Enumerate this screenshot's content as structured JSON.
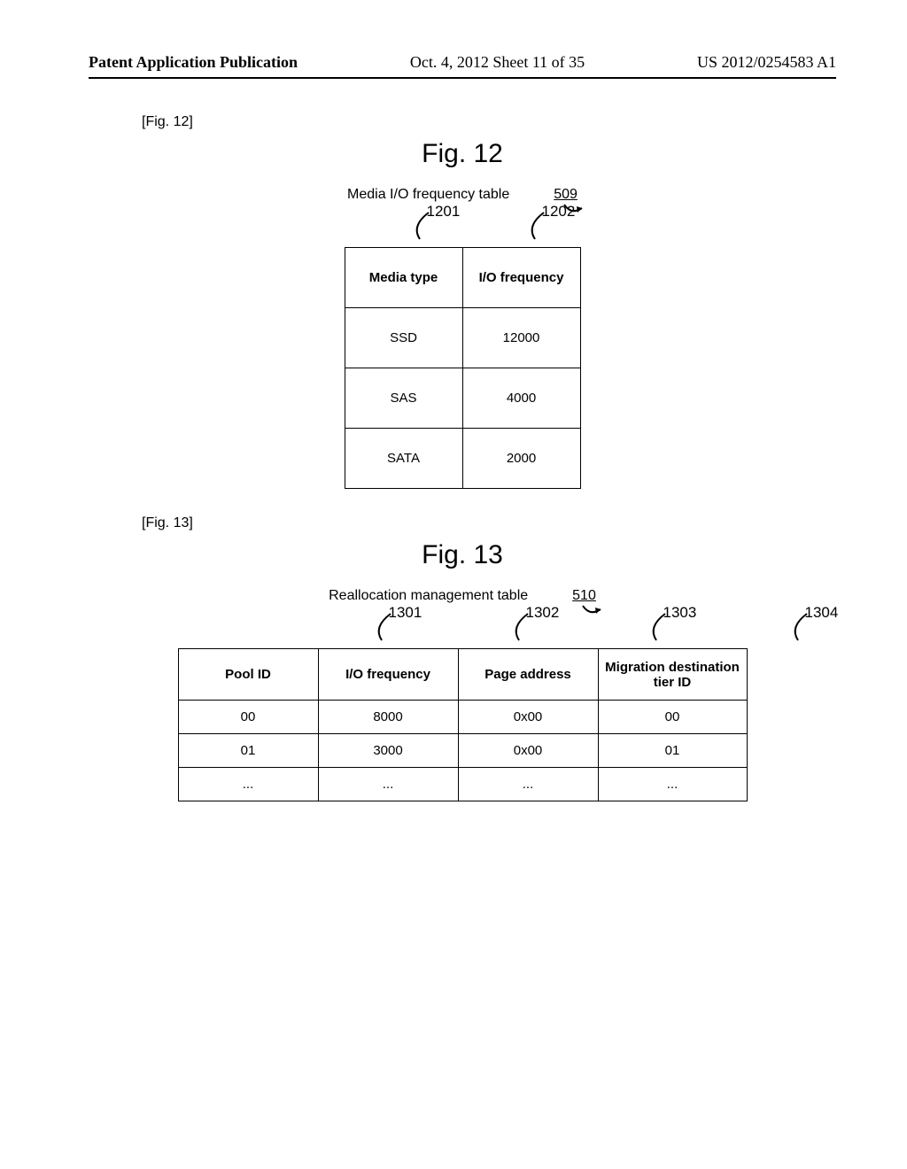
{
  "header": {
    "left": "Patent Application Publication",
    "center": "Oct. 4, 2012  Sheet 11 of 35",
    "right": "US 2012/0254583 A1"
  },
  "fig12": {
    "ref": "[Fig. 12]",
    "title": "Fig. 12",
    "table_label": "Media I/O frequency table",
    "table_ref": "509",
    "col_ids": [
      "1201",
      "1202"
    ],
    "headers": [
      "Media type",
      "I/O frequency"
    ],
    "rows": [
      [
        "SSD",
        "12000"
      ],
      [
        "SAS",
        "4000"
      ],
      [
        "SATA",
        "2000"
      ]
    ]
  },
  "fig13": {
    "ref": "[Fig. 13]",
    "title": "Fig. 13",
    "table_label": "Reallocation management table",
    "table_ref": "510",
    "col_ids": [
      "1301",
      "1302",
      "1303",
      "1304"
    ],
    "headers": [
      "Pool ID",
      "I/O frequency",
      "Page address",
      "Migration destination tier ID"
    ],
    "rows": [
      [
        "00",
        "8000",
        "0x00",
        "00"
      ],
      [
        "01",
        "3000",
        "0x00",
        "01"
      ],
      [
        "...",
        "...",
        "...",
        "..."
      ]
    ]
  }
}
